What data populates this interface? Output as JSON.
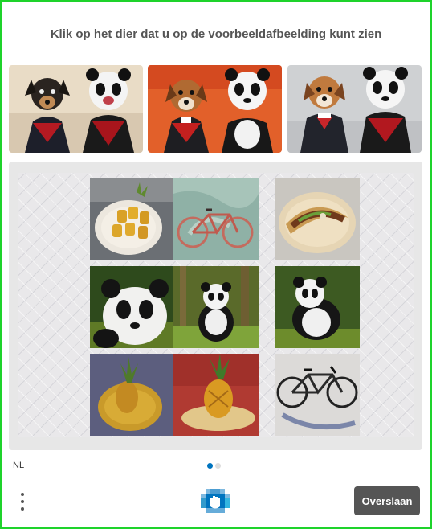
{
  "prompt": "Klik op het dier dat u op de voorbeeldafbeelding kunt zien",
  "example_images": [
    {
      "subject": "dog and panda in vampire costumes, beige background"
    },
    {
      "subject": "dog and panda in vampire costumes, orange background"
    },
    {
      "subject": "dog and panda in vampire costumes, grey background"
    }
  ],
  "grid_tiles": [
    {
      "subject": "pineapple-chunks-on-plate"
    },
    {
      "subject": "bicycle"
    },
    {
      "subject": "taco-on-plate"
    },
    {
      "subject": "panda"
    },
    {
      "subject": "panda-in-forest"
    },
    {
      "subject": "panda-on-rock"
    },
    {
      "subject": "pineapple-on-plate"
    },
    {
      "subject": "pineapple-on-plate"
    },
    {
      "subject": "bicycle-with-shadow"
    }
  ],
  "footer": {
    "language": "NL",
    "pagination": {
      "current": 1,
      "total": 2
    },
    "skip_label": "Overslaan",
    "menu_icon": "vertical-dots-icon",
    "logo_icon": "hcaptcha-hand-icon"
  },
  "colors": {
    "frame_border": "#1ed32b",
    "skip_button": "#555555",
    "active_dot": "#0074bf",
    "inactive_dot": "#dddddd",
    "logo": "#0074bf"
  }
}
